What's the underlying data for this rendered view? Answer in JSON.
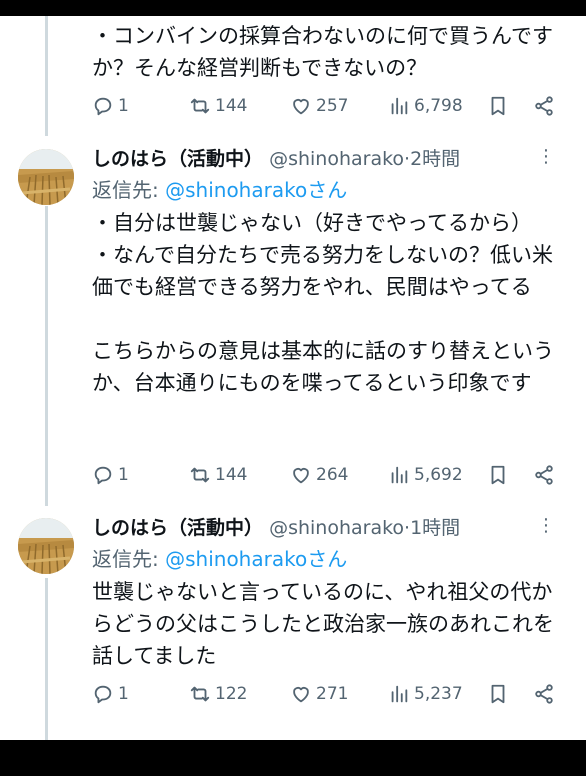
{
  "posts": [
    {
      "body": "・コンバインの採算合わないのに何で買うんですか？そんな経営判断もできないの？",
      "stats": {
        "replies": "1",
        "retweets": "144",
        "likes": "257",
        "views": "6,798"
      }
    },
    {
      "author": {
        "name": "しのはら（活動中）",
        "handle": "@shinoharako"
      },
      "separator": "·",
      "time": "2時間",
      "replying_to": {
        "prefix": "返信先: ",
        "mention": "@shinoharako",
        "suffix": "さん"
      },
      "body": "・自分は世襲じゃない（好きでやってるから）\n・なんで自分たちで売る努力をしないの？低い米価でも経営できる努力をやれ、民間はやってる\n\nこちらからの意見は基本的に話のすり替えというか、台本通りにものを喋ってるという印象です",
      "stats": {
        "replies": "1",
        "retweets": "144",
        "likes": "264",
        "views": "5,692"
      }
    },
    {
      "author": {
        "name": "しのはら（活動中）",
        "handle": "@shinoharako"
      },
      "separator": "·",
      "time": "1時間",
      "replying_to": {
        "prefix": "返信先: ",
        "mention": "@shinoharako",
        "suffix": "さん"
      },
      "body": "世襲じゃないと言っているのに、やれ祖父の代からどうの父はこうしたと政治家一族のあれこれを話してました",
      "stats": {
        "replies": "1",
        "retweets": "122",
        "likes": "271",
        "views": "5,237"
      }
    }
  ],
  "icons": {
    "reply": "reply-icon",
    "retweet": "retweet-icon",
    "like": "heart-icon",
    "views": "views-icon",
    "bookmark": "bookmark-icon",
    "share": "share-icon",
    "more": "more-icon",
    "avatar": "wheat-field-avatar"
  },
  "colors": {
    "text": "#0f1419",
    "secondary": "#536471",
    "link": "#1d9bf0",
    "thread_line": "#cfd9de"
  }
}
